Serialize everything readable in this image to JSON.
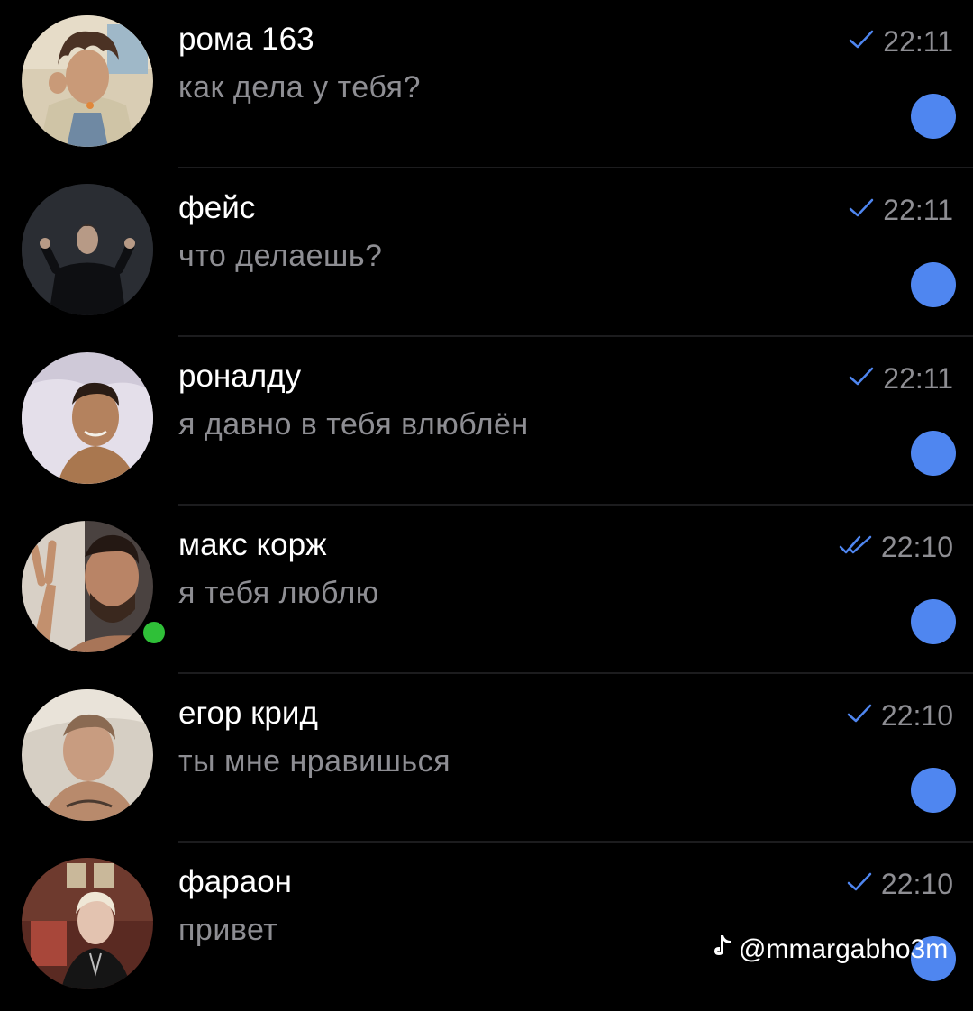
{
  "colors": {
    "background": "#000000",
    "name": "#ffffff",
    "secondary_text": "#8e8e93",
    "accent": "#4f86f0",
    "online": "#2fc038",
    "separator": "#1c1c1e"
  },
  "chats": [
    {
      "name": "рома 163",
      "preview": "как дела у тебя?",
      "time": "22:11",
      "status_icon": "single-check-icon",
      "online": false,
      "unread": true
    },
    {
      "name": "фейс",
      "preview": "что делаешь?",
      "time": "22:11",
      "status_icon": "single-check-icon",
      "online": false,
      "unread": true
    },
    {
      "name": "роналду",
      "preview": "я давно в тебя влюблён",
      "time": "22:11",
      "status_icon": "single-check-icon",
      "online": false,
      "unread": true
    },
    {
      "name": "макс корж",
      "preview": "я тебя люблю",
      "time": "22:10",
      "status_icon": "double-check-icon",
      "online": true,
      "unread": true
    },
    {
      "name": "егор крид",
      "preview": "ты мне нравишься",
      "time": "22:10",
      "status_icon": "single-check-icon",
      "online": false,
      "unread": true
    },
    {
      "name": "фараон",
      "preview": "привет",
      "time": "22:10",
      "status_icon": "single-check-icon",
      "online": false,
      "unread": true
    }
  ],
  "watermark": {
    "icon": "tiktok-icon",
    "text": "@mmargabho3m"
  }
}
